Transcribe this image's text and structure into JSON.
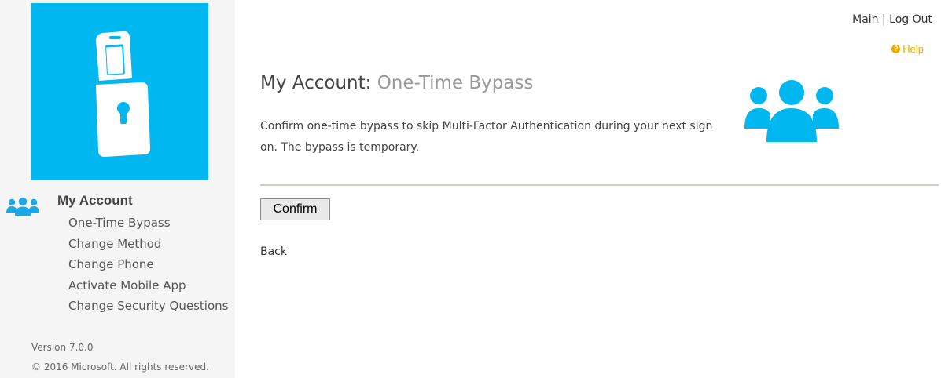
{
  "sidebar": {
    "logo_icon": "phone-lock-icon",
    "section_icon": "users-icon",
    "section_title": "My Account",
    "items": [
      {
        "label": "One-Time Bypass"
      },
      {
        "label": "Change Method"
      },
      {
        "label": "Change Phone"
      },
      {
        "label": "Activate Mobile App"
      },
      {
        "label": "Change Security Questions"
      }
    ],
    "version": "Version 7.0.0",
    "copyright": "© 2016 Microsoft. All rights reserved."
  },
  "header": {
    "main_link": "Main",
    "separator": "|",
    "logout_link": "Log Out",
    "help_label": "Help",
    "help_icon": "help-icon"
  },
  "main": {
    "title_prefix": "My Account:",
    "title_page": "One-Time Bypass",
    "description": "Confirm one-time bypass to skip Multi-Factor Authentication during your next sign on. The bypass is temporary.",
    "hero_icon": "users-icon",
    "confirm_label": "Confirm",
    "back_label": "Back"
  },
  "colors": {
    "accent": "#00b8ef",
    "help": "#f0a800",
    "divider": "#d0ccc4"
  }
}
